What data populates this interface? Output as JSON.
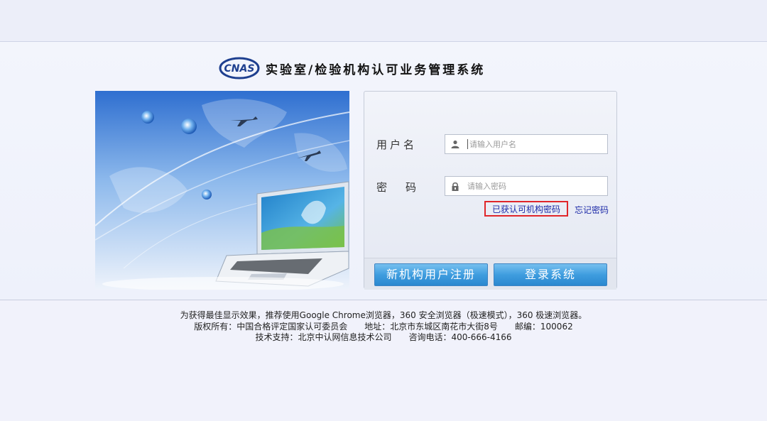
{
  "header": {
    "logo_text": "CNAS",
    "title": "实验室/检验机构认可业务管理系统"
  },
  "login": {
    "username_label": "用户名",
    "username_placeholder": "请输入用户名",
    "password_label_1": "密",
    "password_label_2": "码",
    "password_placeholder": "请输入密码",
    "cert_password_link": "已获认可机构密码",
    "forgot_password_link": "忘记密码",
    "register_button": "新机构用户注册",
    "login_button": "登录系统"
  },
  "footer": {
    "line1": "为获得最佳显示效果，推荐使用Google Chrome浏览器，360 安全浏览器（极速模式），360 极速浏览器。",
    "line2": "版权所有：中国合格评定国家认可委员会　　地址：北京市东城区南花市大街8号　　邮编：100062",
    "line3": "技术支持：北京中认网信息技术公司　　咨询电话：400-666-4166"
  },
  "colors": {
    "accent_blue": "#3f9ddf",
    "link_blue": "#1d2aa8",
    "highlight_red": "#e0262a"
  }
}
